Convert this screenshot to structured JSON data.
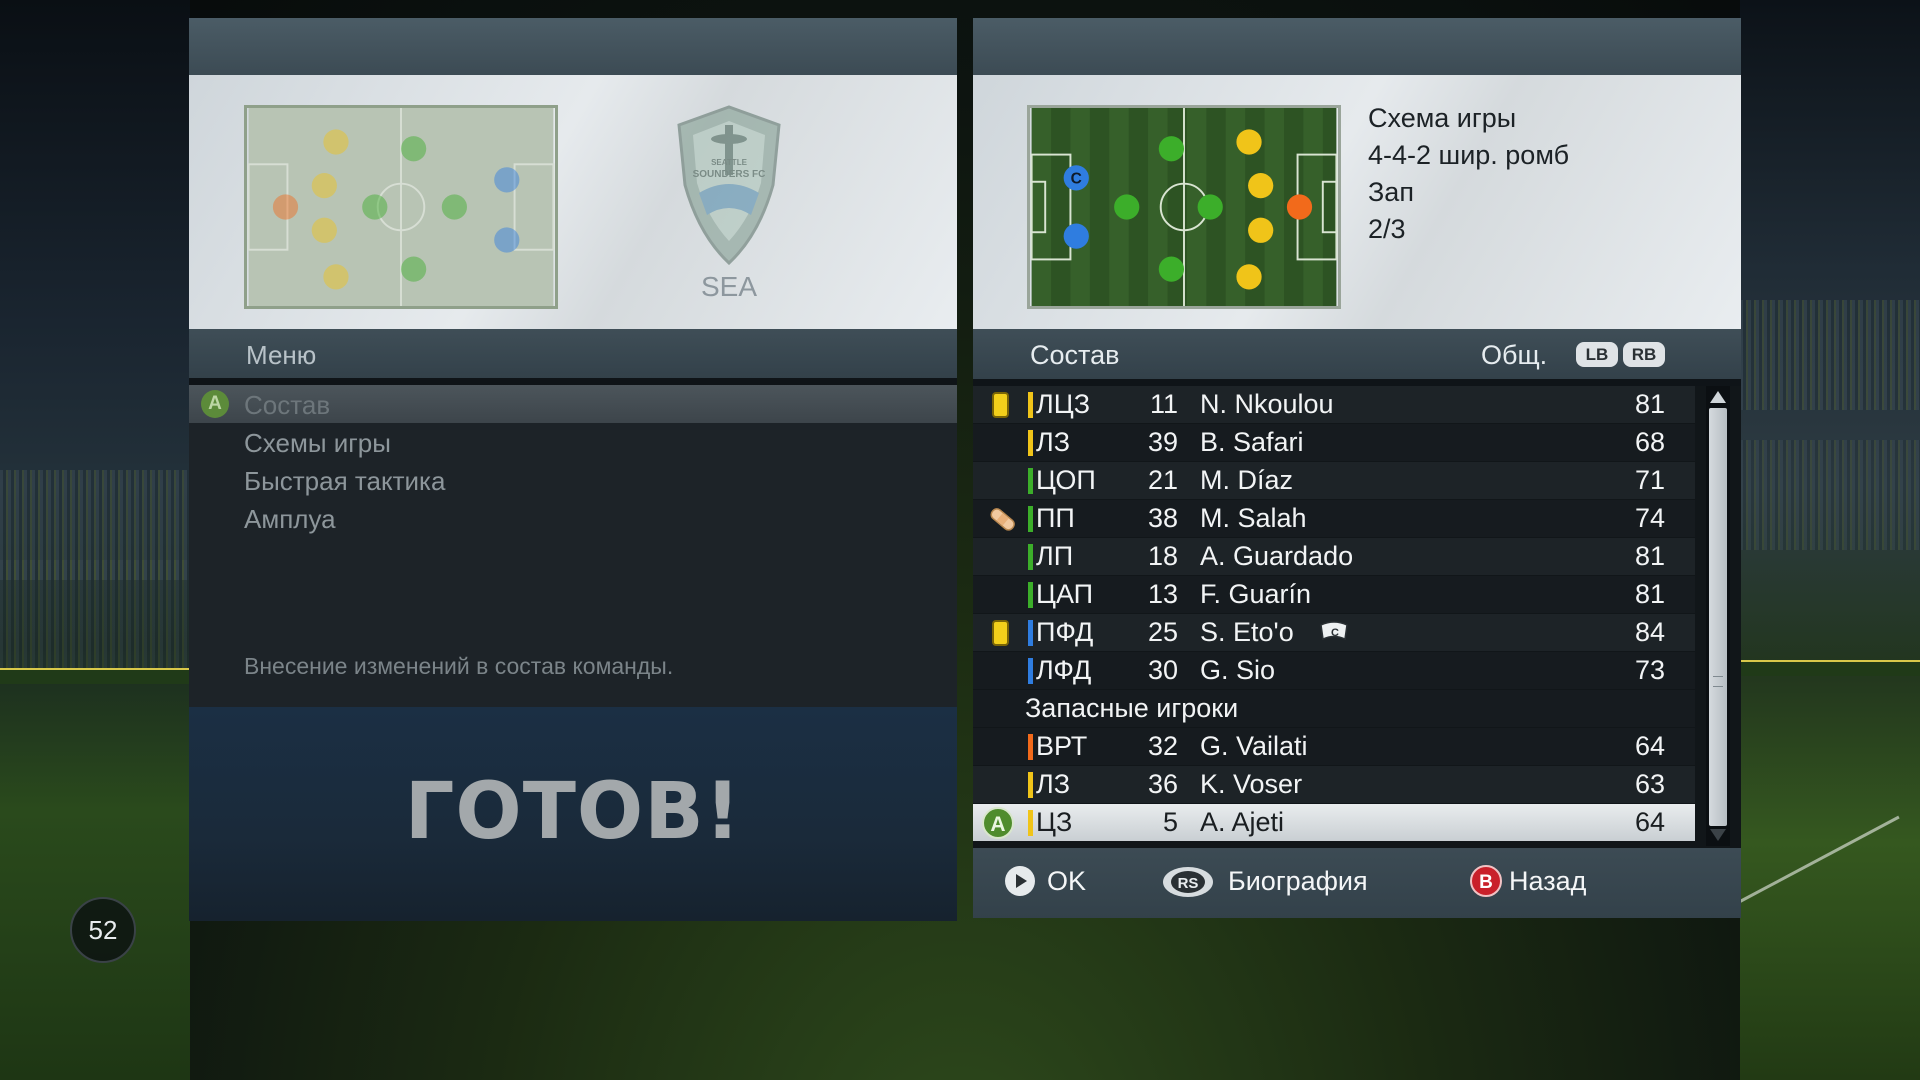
{
  "left_panel": {
    "team_abbr": "SEA",
    "logo_text_top": "SEATTLE",
    "logo_text_main": "SOUNDERS FC",
    "menu_title": "Меню",
    "menu_items": [
      {
        "label": "Состав",
        "selected": true,
        "badge": "A"
      },
      {
        "label": "Схемы игры",
        "selected": false
      },
      {
        "label": "Быстрая тактика",
        "selected": false
      },
      {
        "label": "Амплуа",
        "selected": false
      }
    ],
    "menu_description": "Внесение изменений в состав команды.",
    "ready_text": "ГОТОВ!"
  },
  "right_panel": {
    "formation_label": "Схема игры",
    "formation_name": "4-4-2 шир. ромб",
    "mentality": "Зап",
    "mentality_level": "2/3",
    "captain_marker": "C",
    "roster_title": "Состав",
    "overall_label": "Общ.",
    "bumper_left": "LB",
    "bumper_right": "RB",
    "starters": [
      {
        "pos": "ЛЦЗ",
        "num": "11",
        "name": "N. Nkoulou",
        "rating": "81",
        "pos_color": "#f0c419",
        "status": "yellow-card"
      },
      {
        "pos": "ЛЗ",
        "num": "39",
        "name": "B. Safari",
        "rating": "68",
        "pos_color": "#f0c419",
        "status": ""
      },
      {
        "pos": "ЦОП",
        "num": "21",
        "name": "M. Díaz",
        "rating": "71",
        "pos_color": "#3cae2a",
        "status": ""
      },
      {
        "pos": "ПП",
        "num": "38",
        "name": "M. Salah",
        "rating": "74",
        "pos_color": "#3cae2a",
        "status": "injury"
      },
      {
        "pos": "ЛП",
        "num": "18",
        "name": "A. Guardado",
        "rating": "81",
        "pos_color": "#3cae2a",
        "status": ""
      },
      {
        "pos": "ЦАП",
        "num": "13",
        "name": "F. Guarín",
        "rating": "81",
        "pos_color": "#3cae2a",
        "status": ""
      },
      {
        "pos": "ПФД",
        "num": "25",
        "name": "S. Eto'o",
        "rating": "84",
        "pos_color": "#2f7de0",
        "status": "yellow-card",
        "captain": true
      },
      {
        "pos": "ЛФД",
        "num": "30",
        "name": "G. Sio",
        "rating": "73",
        "pos_color": "#2f7de0",
        "status": ""
      }
    ],
    "subs_header": "Запасные игроки",
    "subs": [
      {
        "pos": "ВРТ",
        "num": "32",
        "name": "G. Vailati",
        "rating": "64",
        "pos_color": "#f26a1b"
      },
      {
        "pos": "ЛЗ",
        "num": "36",
        "name": "K. Voser",
        "rating": "63",
        "pos_color": "#f0c419"
      },
      {
        "pos": "ЦЗ",
        "num": "5",
        "name": "A. Ajeti",
        "rating": "64",
        "pos_color": "#f0c419",
        "selected": true,
        "badge": "A"
      }
    ],
    "footer": {
      "ok_label": "OK",
      "rs_icon_label": "RS",
      "bio_label": "Биография",
      "back_icon_label": "B",
      "back_label": "Назад"
    }
  },
  "corner_counter": "52",
  "colors": {
    "gk": "#f26a1b",
    "defender": "#f0c419",
    "midfielder": "#3cae2a",
    "forward": "#2f7de0"
  }
}
